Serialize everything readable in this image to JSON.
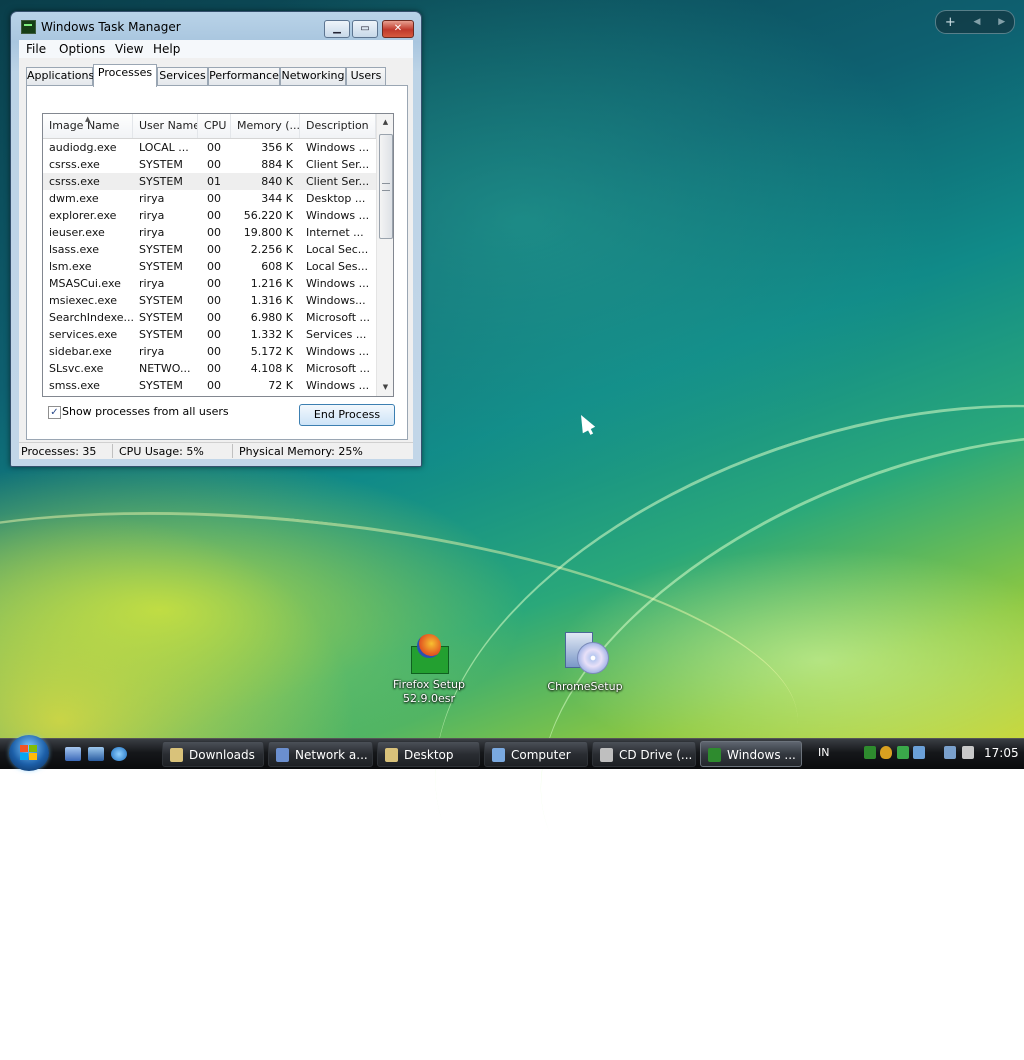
{
  "window": {
    "title": "Windows Task Manager",
    "menu": [
      "File",
      "Options",
      "View",
      "Help"
    ],
    "tabs": [
      "Applications",
      "Processes",
      "Services",
      "Performance",
      "Networking",
      "Users"
    ],
    "active_tab": "Processes",
    "columns": [
      "Image Name",
      "User Name",
      "CPU",
      "Memory (...",
      "Description"
    ],
    "rows": [
      {
        "name": "audiodg.exe",
        "user": "LOCAL ...",
        "cpu": "00",
        "mem": "356 K",
        "desc": "Windows ..."
      },
      {
        "name": "csrss.exe",
        "user": "SYSTEM",
        "cpu": "00",
        "mem": "884 K",
        "desc": "Client Ser..."
      },
      {
        "name": "csrss.exe",
        "user": "SYSTEM",
        "cpu": "01",
        "mem": "840 K",
        "desc": "Client Ser..."
      },
      {
        "name": "dwm.exe",
        "user": "rirya",
        "cpu": "00",
        "mem": "344 K",
        "desc": "Desktop ..."
      },
      {
        "name": "explorer.exe",
        "user": "rirya",
        "cpu": "00",
        "mem": "56.220 K",
        "desc": "Windows ..."
      },
      {
        "name": "ieuser.exe",
        "user": "rirya",
        "cpu": "00",
        "mem": "19.800 K",
        "desc": "Internet ..."
      },
      {
        "name": "lsass.exe",
        "user": "SYSTEM",
        "cpu": "00",
        "mem": "2.256 K",
        "desc": "Local Sec..."
      },
      {
        "name": "lsm.exe",
        "user": "SYSTEM",
        "cpu": "00",
        "mem": "608 K",
        "desc": "Local Ses..."
      },
      {
        "name": "MSASCui.exe",
        "user": "rirya",
        "cpu": "00",
        "mem": "1.216 K",
        "desc": "Windows ..."
      },
      {
        "name": "msiexec.exe",
        "user": "SYSTEM",
        "cpu": "00",
        "mem": "1.316 K",
        "desc": "Windows..."
      },
      {
        "name": "SearchIndexe...",
        "user": "SYSTEM",
        "cpu": "00",
        "mem": "6.980 K",
        "desc": "Microsoft ..."
      },
      {
        "name": "services.exe",
        "user": "SYSTEM",
        "cpu": "00",
        "mem": "1.332 K",
        "desc": "Services ..."
      },
      {
        "name": "sidebar.exe",
        "user": "rirya",
        "cpu": "00",
        "mem": "5.172 K",
        "desc": "Windows ..."
      },
      {
        "name": "SLsvc.exe",
        "user": "NETWO...",
        "cpu": "00",
        "mem": "4.108 K",
        "desc": "Microsoft ..."
      },
      {
        "name": "smss.exe",
        "user": "SYSTEM",
        "cpu": "00",
        "mem": "72 K",
        "desc": "Windows ..."
      }
    ],
    "selected_row": 2,
    "show_all_label": "Show processes from all users",
    "show_all_checked": true,
    "end_process_label": "End Process",
    "status": {
      "processes": "Processes: 35",
      "cpu": "CPU Usage: 5%",
      "memory": "Physical Memory: 25%"
    }
  },
  "desktop_icons": [
    {
      "label_line1": "Firefox Setup",
      "label_line2": "52.9.0esr",
      "icon": "firefox-setup-icon"
    },
    {
      "label_line1": "ChromeSetup",
      "label_line2": "",
      "icon": "cd-setup-icon"
    }
  ],
  "taskbar": {
    "buttons": [
      {
        "label": "Downloads",
        "icon": "folder-icon",
        "color": "#d9c27a"
      },
      {
        "label": "Network a...",
        "icon": "network-icon",
        "color": "#6b8fcf"
      },
      {
        "label": "Desktop",
        "icon": "folder-icon",
        "color": "#d9c27a"
      },
      {
        "label": "Computer",
        "icon": "computer-icon",
        "color": "#7aa9e0"
      },
      {
        "label": "CD Drive (...",
        "icon": "cd-drive-icon",
        "color": "#bfbfbf"
      },
      {
        "label": "Windows ...",
        "icon": "task-manager-icon",
        "color": "#2e8b2e"
      }
    ],
    "language": "IN",
    "clock": "17:05"
  },
  "colors": {
    "accent": "#3c7fb1",
    "close_button": "#c0392b",
    "taskbar": "#15171a"
  }
}
